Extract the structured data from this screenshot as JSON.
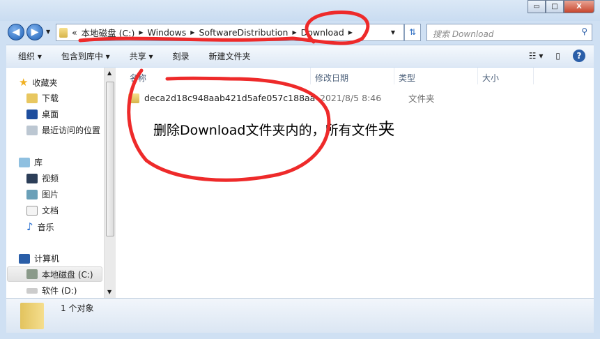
{
  "window": {
    "minimize": "▭",
    "maximize": "□",
    "close": "X"
  },
  "address": {
    "overflow": "«",
    "crumbs": [
      "本地磁盘 (C:)",
      "Windows",
      "SoftwareDistribution",
      "Download"
    ]
  },
  "search": {
    "placeholder": "搜索 Download"
  },
  "toolbar": {
    "organize": "组织 ▾",
    "include": "包含到库中 ▾",
    "share": "共享 ▾",
    "burn": "刻录",
    "new_folder": "新建文件夹",
    "help": "?"
  },
  "nav": {
    "favorites": "收藏夹",
    "downloads": "下载",
    "desktop": "桌面",
    "recent": "最近访问的位置",
    "libraries": "库",
    "videos": "视频",
    "pictures": "图片",
    "documents": "文档",
    "music": "音乐",
    "computer": "计算机",
    "drive_c": "本地磁盘 (C:)",
    "drive_d": "软件 (D:)"
  },
  "columns": {
    "name": "名称",
    "date": "修改日期",
    "type": "类型",
    "size": "大小"
  },
  "files": [
    {
      "name": "deca2d18c948aab421d5afe057c188aa",
      "date": "2021/8/5 8:46",
      "type": "文件夹"
    }
  ],
  "annotation": {
    "text": "删除Download文件夹内的，所有文件",
    "last": "夹"
  },
  "status": {
    "count": "1 个对象"
  },
  "colors": {
    "annotation": "#ee2a2a"
  }
}
